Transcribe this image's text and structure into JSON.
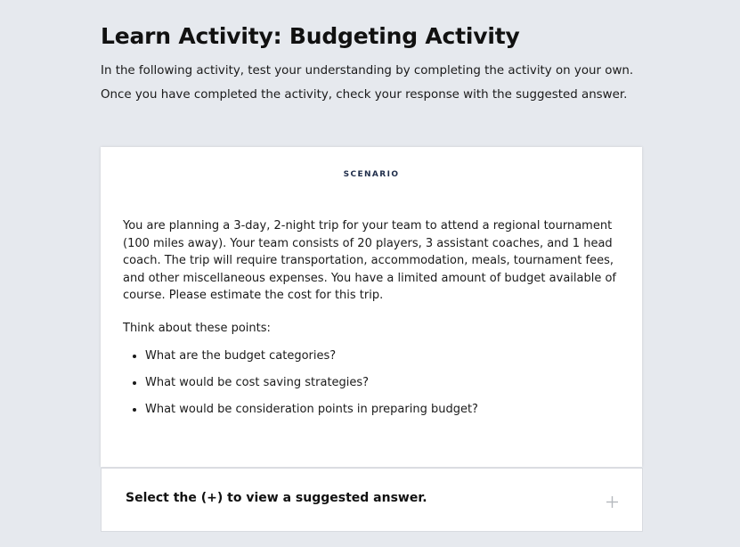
{
  "header": {
    "title": "Learn Activity: Budgeting Activity",
    "intro_line_1": "In the following activity, test your understanding by completing the activity on your own.",
    "intro_line_2": "Once you have completed the activity, check your response with the suggested answer."
  },
  "scenario": {
    "label": "SCENARIO",
    "text": "You are planning a 3-day, 2-night trip for your team to attend a regional tournament (100 miles away). Your team consists of 20 players, 3 assistant coaches, and 1 head coach. The trip will require transportation, accommodation, meals, tournament fees, and other miscellaneous expenses. You have a limited amount of budget available of course. Please estimate the cost for this trip.",
    "points_intro": "Think about these points:",
    "points": [
      "What are the budget categories?",
      "What would be cost saving strategies?",
      "What would be consideration points in preparing budget?"
    ]
  },
  "accordion": {
    "title": "Select the (+) to view a suggested answer.",
    "icon": "plus-icon"
  }
}
